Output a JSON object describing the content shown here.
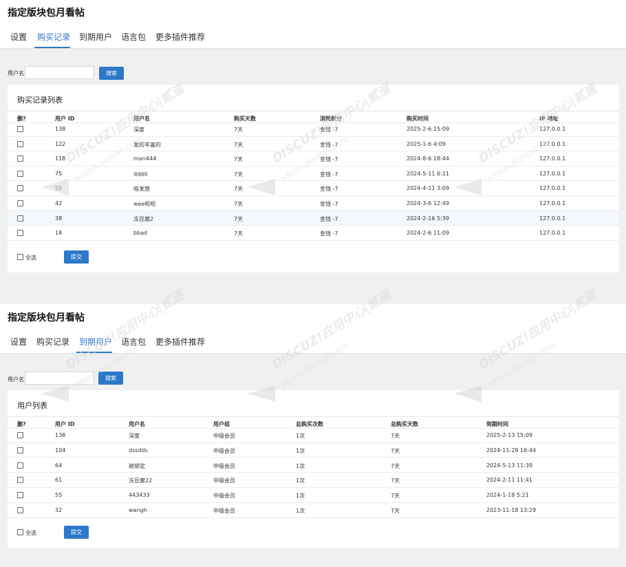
{
  "panel1": {
    "title": "指定版块包月看帖",
    "tabs": [
      "设置",
      "购买记录",
      "到期用户",
      "语言包",
      "更多插件推荐"
    ],
    "active_tab": 1,
    "search": {
      "label": "用户名",
      "value": "",
      "placeholder": "",
      "button": "搜索"
    },
    "card_title": "购买记录列表",
    "columns": [
      "删?",
      "用户 ID",
      "用户名",
      "购买天数",
      "消耗积分",
      "购买时间",
      "IP 地址"
    ],
    "rows": [
      [
        "138",
        "深度",
        "7天",
        "金钱 -7",
        "2025-2-6 15:09",
        "127.0.0.1"
      ],
      [
        "122",
        "发的丰富的",
        "7天",
        "金钱 -7",
        "2025-1-6 4:09",
        "127.0.0.1"
      ],
      [
        "118",
        "man444",
        "7天",
        "金钱 -7",
        "2024-8-6 18:44",
        "127.0.0.1"
      ],
      [
        "75",
        "qqqq",
        "7天",
        "金钱 -7",
        "2024-5-11 6:11",
        "127.0.0.1"
      ],
      [
        "55",
        "啥发放",
        "7天",
        "金钱 -7",
        "2024-4-11 3:09",
        "127.0.0.1"
      ],
      [
        "42",
        "wee呃呃",
        "7天",
        "金钱 -7",
        "2024-3-6 12:49",
        "127.0.0.1"
      ],
      [
        "38",
        "冻豆腐2",
        "7天",
        "金钱 -7",
        "2024-2-16 5:39",
        "127.0.0.1"
      ],
      [
        "18",
        "bbad",
        "7天",
        "金钱 -7",
        "2024-2-6 11:09",
        "127.0.0.1"
      ]
    ],
    "highlight_row": 6,
    "select_all": "全选",
    "submit": "提交"
  },
  "panel2": {
    "title": "指定版块包月看帖",
    "tabs": [
      "设置",
      "购买记录",
      "到期用户",
      "语言包",
      "更多插件推荐"
    ],
    "active_tab": 2,
    "search": {
      "label": "用户名",
      "value": "",
      "placeholder": "",
      "button": "搜索"
    },
    "card_title": "用户列表",
    "columns": [
      "删?",
      "用户 ID",
      "用户名",
      "用户组",
      "总购买次数",
      "总购买天数",
      "到期时间"
    ],
    "rows": [
      [
        "138",
        "深度",
        "中级会员",
        "1次",
        "7天",
        "2025-2-13 15:09"
      ],
      [
        "104",
        "dssdds",
        "中级会员",
        "1次",
        "7天",
        "2024-11-28 16:44"
      ],
      [
        "64",
        "被绑定",
        "中级会员",
        "1次",
        "7天",
        "2024-5-13 11:39"
      ],
      [
        "61",
        "冻豆腐22",
        "中级会员",
        "1次",
        "7天",
        "2024-2-11 11:41"
      ],
      [
        "55",
        "443433",
        "中级会员",
        "1次",
        "7天",
        "2024-1-18 5:21"
      ],
      [
        "32",
        "wangh",
        "中级会员",
        "1次",
        "7天",
        "2023-11-18 13:29"
      ]
    ],
    "select_all": "全选",
    "submit": "提交"
  },
  "watermark": {
    "brand": "DISCUZ!应用中心|贰道",
    "domain": "addon.dismall.com"
  },
  "colors": {
    "accent": "#2d78c9",
    "background": "#f0f0f0",
    "highlight_row": "#f2f8fd"
  }
}
